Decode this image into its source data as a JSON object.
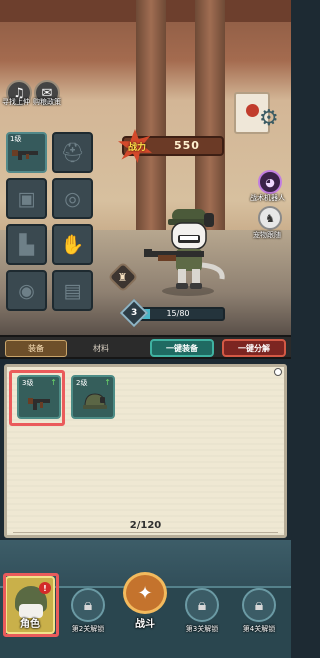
{
  "top_left_buttons": [
    {
      "label": "寻找上仲",
      "icon": "bell-icon"
    },
    {
      "label": "购粮政策",
      "icon": "scroll-icon"
    }
  ],
  "equipment": {
    "slots": [
      {
        "name": "weapon",
        "level": "1级",
        "filled": true,
        "icon": "rifle-icon"
      },
      {
        "name": "helmet",
        "level": "",
        "filled": false,
        "icon": "helmet-icon"
      },
      {
        "name": "armor",
        "level": "",
        "filled": false,
        "icon": "vest-icon"
      },
      {
        "name": "belt",
        "level": "",
        "filled": false,
        "icon": "belt-icon"
      },
      {
        "name": "boots",
        "level": "",
        "filled": false,
        "icon": "boots-icon"
      },
      {
        "name": "gloves",
        "level": "",
        "filled": false,
        "icon": "gloves-icon"
      },
      {
        "name": "goggles",
        "level": "",
        "filled": false,
        "icon": "goggles-icon"
      },
      {
        "name": "backpack",
        "level": "",
        "filled": false,
        "icon": "backpack-icon"
      }
    ]
  },
  "power": {
    "label": "战力",
    "value": "550"
  },
  "settings_icon": "gear-icon",
  "side_buttons": [
    {
      "label": "战术机器人",
      "icon": "robot-icon"
    },
    {
      "label": "宠物跟随",
      "icon": "pet-icon"
    }
  ],
  "character": {
    "level": "3",
    "exp_text": "15/80",
    "exp_fraction": 0.1875
  },
  "tabs": {
    "equipment": "装备",
    "materials": "材料"
  },
  "actions": {
    "equip_all": "一键装备",
    "decompose_all": "一键分解"
  },
  "inventory": {
    "items": [
      {
        "level": "3级",
        "upgrade": "↑",
        "icon": "rifle-icon"
      },
      {
        "level": "2级",
        "upgrade": "↑",
        "icon": "helmet-icon"
      }
    ],
    "count": "2/120"
  },
  "bottom_nav": {
    "role": {
      "label": "角色",
      "badge": "!"
    },
    "items": [
      {
        "label": "第2关解锁",
        "icon": "lock-icon"
      },
      {
        "label": "战斗",
        "icon": "battle-icon"
      },
      {
        "label": "第3关解锁",
        "icon": "lock-icon"
      },
      {
        "label": "第4关解锁",
        "icon": "lock-icon"
      }
    ]
  }
}
